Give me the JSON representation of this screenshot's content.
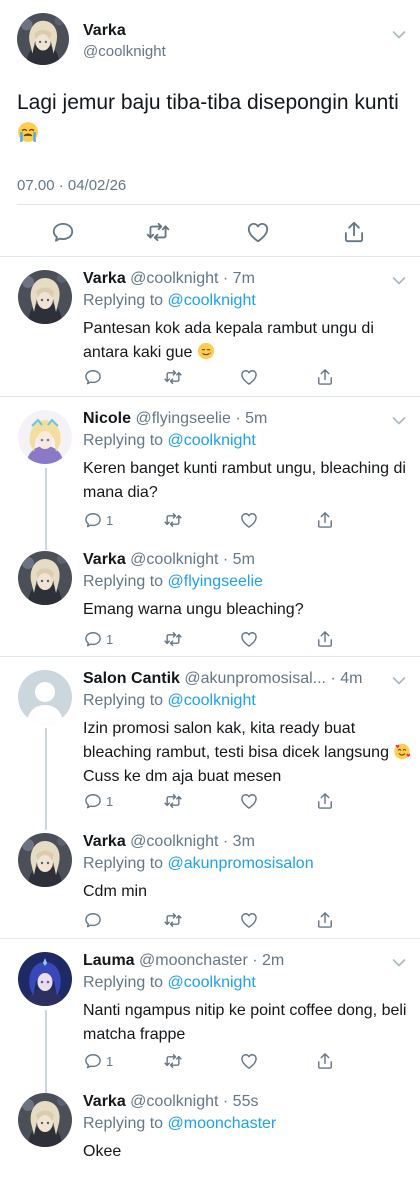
{
  "main_tweet": {
    "name": "Varka",
    "handle": "@coolknight",
    "text": "Lagi jemur baju tiba-tiba disepongin kunti",
    "emoji": "😭",
    "timestamp": "07.00 · 04/02/26"
  },
  "replies": [
    {
      "name": "Varka",
      "meta": "@coolknight · 7m",
      "replying_prefix": "Replying to ",
      "replying_to": "@coolknight",
      "text": "Pantesan kok ada kepala rambut ungu di antara kaki gue",
      "emoji": "🥲",
      "reply_count": ""
    },
    {
      "name": "Nicole",
      "meta": "@flyingseelie · 5m",
      "replying_prefix": "Replying to ",
      "replying_to": "@coolknight",
      "text": "Keren banget kunti rambut ungu, bleaching di mana dia?",
      "reply_count": "1"
    },
    {
      "name": "Varka",
      "meta": "@coolknight · 5m",
      "replying_prefix": "Replying to ",
      "replying_to": "@flyingseelie",
      "text": "Emang warna ungu bleaching?",
      "reply_count": "1"
    },
    {
      "name": "Salon Cantik",
      "meta": "@akunpromosisal... · 4m",
      "replying_prefix": "Replying to ",
      "replying_to": "@coolknight",
      "text_before": "Izin promosi salon kak, kita ready buat bleaching rambut, testi bisa dicek langsung",
      "emoji": "🥰",
      "text_after": " Cuss ke dm aja buat mesen",
      "reply_count": "1"
    },
    {
      "name": "Varka",
      "meta": "@coolknight · 3m",
      "replying_prefix": "Replying to ",
      "replying_to": "@akunpromosisalon",
      "text": "Cdm min",
      "reply_count": ""
    },
    {
      "name": "Lauma",
      "meta": "@moonchaster · 2m",
      "replying_prefix": "Replying to ",
      "replying_to": "@coolknight",
      "text": "Nanti ngampus nitip ke point coffee dong, beli matcha frappe",
      "reply_count": "1"
    },
    {
      "name": "Varka",
      "meta": "@coolknight · 55s",
      "replying_prefix": "Replying to ",
      "replying_to": "@moonchaster",
      "text": "Okee",
      "reply_count": ""
    }
  ],
  "colors": {
    "link": "#1da1f2",
    "secondary_text": "#657786",
    "divider": "#e1e8ed",
    "thread_line": "#ccd6dd"
  }
}
